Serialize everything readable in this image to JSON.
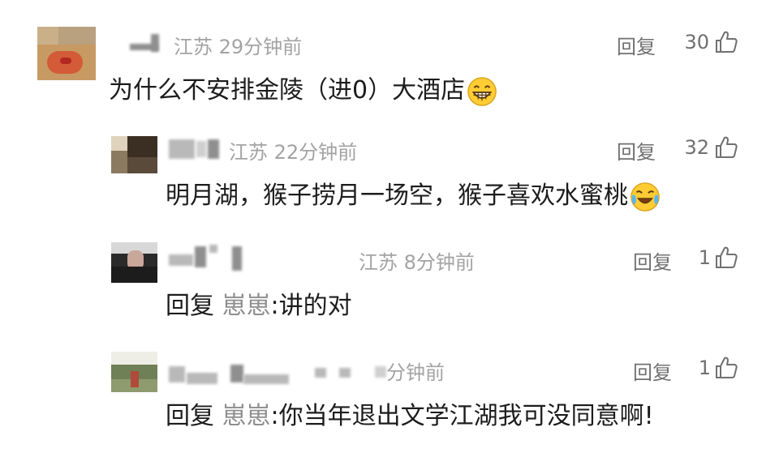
{
  "comments": [
    {
      "location": "江苏",
      "time": "29分钟前",
      "text": "为什么不安排金陵（进0）大酒店",
      "emoji": "grinning-face-emoji",
      "reply_label": "回复",
      "likes": "30"
    },
    {
      "location": "江苏",
      "time": "22分钟前",
      "text": "明月湖，猴子捞月一场空，猴子喜欢水蜜桃",
      "emoji": "crying-laughing-face-emoji",
      "reply_label": "回复",
      "likes": "32"
    },
    {
      "location": "江苏",
      "time": "8分钟前",
      "reply_prefix": "回复",
      "reply_target": "崽崽",
      "separator": ":",
      "text": "讲的对",
      "reply_label": "回复",
      "likes": "1"
    },
    {
      "time": "分钟前",
      "reply_prefix": "回复",
      "reply_target": "崽崽",
      "separator": ":",
      "text": "你当年退出文学江湖我可没同意啊!",
      "reply_label": "回复",
      "likes": "1"
    }
  ],
  "icons": {
    "like": "thumbs-up-outline-icon"
  },
  "colors": {
    "meta_text": "#a3a3a3",
    "action_text": "#707070",
    "reply_target": "#8e8e8e"
  }
}
